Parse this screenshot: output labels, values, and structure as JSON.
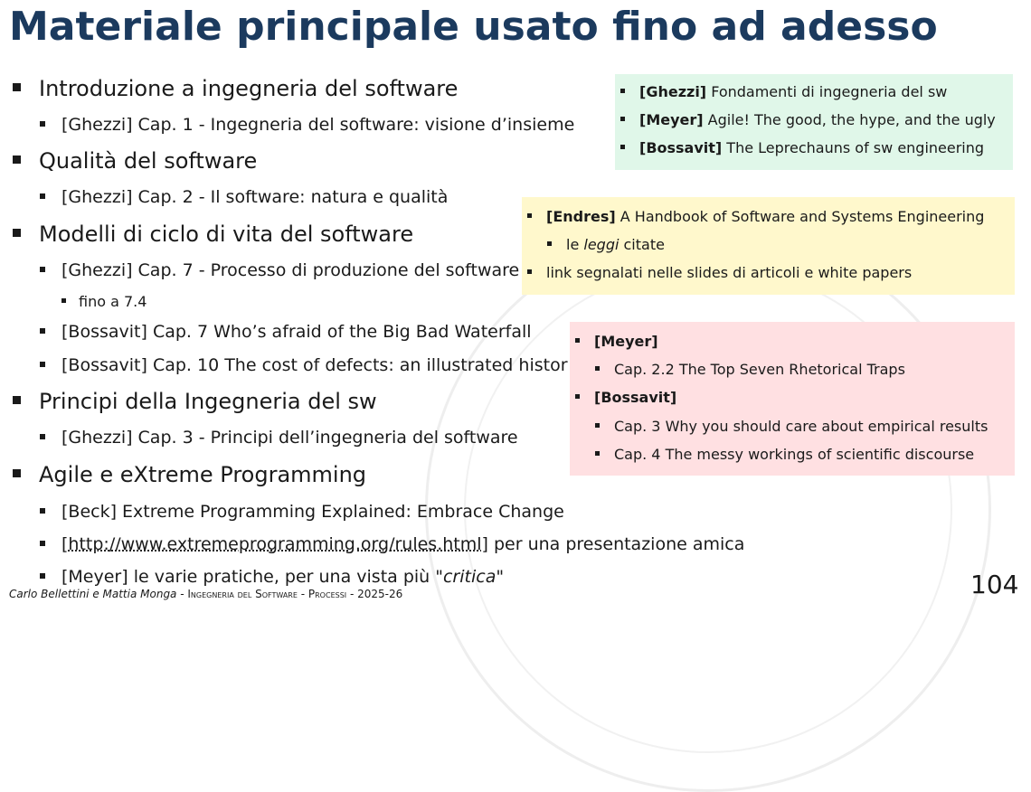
{
  "title": "Materiale principale usato fino ad adesso",
  "main_list": [
    {
      "level": 1,
      "text": "Introduzione a ingegneria del software"
    },
    {
      "level": 2,
      "text": "[Ghezzi] Cap. 1 - Ingegneria del software: visione d’insieme"
    },
    {
      "level": 1,
      "text": "Qualità del software"
    },
    {
      "level": 2,
      "text": "[Ghezzi] Cap. 2 - Il software: natura e qualità"
    },
    {
      "level": 1,
      "text": "Modelli di ciclo di vita del software"
    },
    {
      "level": 2,
      "text": "[Ghezzi] Cap. 7 - Processo di produzione del software"
    },
    {
      "level": 3,
      "text": "fino a 7.4"
    },
    {
      "level": 2,
      "text": "[Bossavit] Cap. 7 Who’s afraid of the Big Bad Waterfall"
    },
    {
      "level": 2,
      "text": "[Bossavit] Cap. 10 The cost of defects: an illustrated histor"
    },
    {
      "level": 1,
      "text": "Principi della Ingegneria del sw"
    },
    {
      "level": 2,
      "text": "[Ghezzi] Cap. 3 - Principi dell’ingegneria del software"
    },
    {
      "level": 1,
      "text": "Agile e eXtreme Programming"
    },
    {
      "level": 2,
      "text": "[Beck] Extreme Programming Explained: Embrace Change"
    }
  ],
  "xp_link_item": {
    "open": "[",
    "link": "http://www.extremeprogramming.org/rules.html",
    "close": "] per una presentazione amica"
  },
  "meyer_item": {
    "prefix": "[Meyer] le varie pratiche, per una vista più ",
    "emphasis": "\"critica\""
  },
  "green_box": [
    {
      "tag": "[Ghezzi]",
      "text": " Fondamenti di ingegneria del sw"
    },
    {
      "tag": "[Meyer]",
      "text": " Agile! The good, the hype, and the ugly"
    },
    {
      "tag": "[Bossavit]",
      "text": " The Leprechauns of sw engineering"
    }
  ],
  "yellow_box": {
    "item1_tag": "[Endres]",
    "item1_text": " A Handbook of Software and Systems Engineering",
    "sub_prefix": "le ",
    "sub_emphasis": "leggi",
    "sub_suffix": " citate",
    "item2_text": "link segnalati nelle slides di articoli e white papers"
  },
  "pink_box": {
    "meyer_tag": "[Meyer]",
    "meyer_sub": "Cap. 2.2 The Top Seven Rhetorical Traps",
    "bossavit_tag": "[Bossavit]",
    "bossavit_sub1": "Cap. 3 Why you should care about empirical results",
    "bossavit_sub2": "Cap. 4 The messy workings of scientific discourse"
  },
  "footer": {
    "names": "Carlo Bellettini e Mattia Monga",
    "sep1": " - ",
    "course": "Ingegneria del Software",
    "sep2": " - ",
    "topic": "Processi",
    "sep3": " - ",
    "year": "2025-26"
  },
  "page_number": "104",
  "colors": {
    "title": "#1b3a5e",
    "green_box": "#e0f7e9",
    "yellow_box": "#fff8cc",
    "pink_box": "#ffe0e2"
  }
}
